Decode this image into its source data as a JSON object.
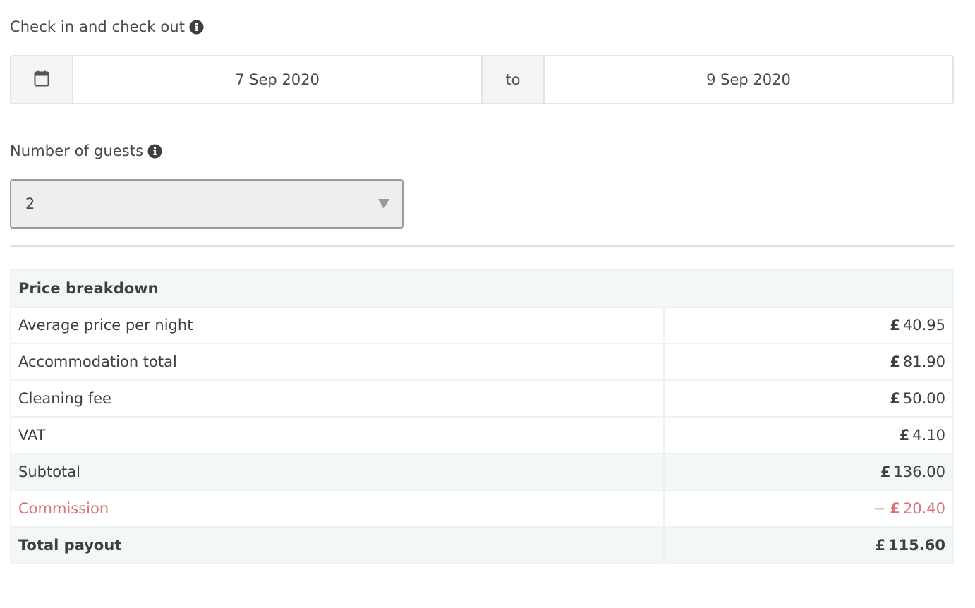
{
  "checkin": {
    "label": "Check in and check out",
    "info_icon": "info-circle-icon",
    "calendar_icon": "calendar-icon",
    "start_date": "7 Sep 2020",
    "separator": "to",
    "end_date": "9 Sep 2020"
  },
  "guests": {
    "label": "Number of guests",
    "info_icon": "info-circle-icon",
    "selected": "2"
  },
  "price_breakdown": {
    "heading": "Price breakdown",
    "currency_symbol": "£",
    "rows": [
      {
        "label": "Average price per night",
        "amount": "40.95"
      },
      {
        "label": "Accommodation total",
        "amount": "81.90"
      },
      {
        "label": "Cleaning fee",
        "amount": "50.00"
      },
      {
        "label": "VAT",
        "amount": "4.10"
      },
      {
        "label": "Subtotal",
        "amount": "136.00"
      },
      {
        "label": "Commission",
        "sign": "−",
        "amount": "20.40"
      },
      {
        "label": "Total payout",
        "amount": "115.60"
      }
    ]
  },
  "colors": {
    "commission": "#d9727b",
    "shaded_row": "#f3f7f6",
    "border": "#e3e3e3"
  }
}
